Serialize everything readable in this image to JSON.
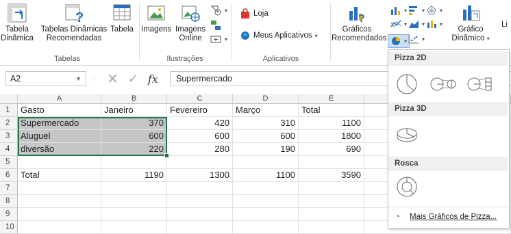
{
  "ribbon": {
    "tabelas": {
      "group_label": "Tabelas",
      "tabela_dinamica_line1": "Tabela",
      "tabela_dinamica_line2": "Dinâmica",
      "tabelas_recomendadas_line1": "Tabelas Dinâmicas",
      "tabelas_recomendadas_line2": "Recomendadas",
      "tabela": "Tabela"
    },
    "ilustracoes": {
      "group_label": "Ilustrações",
      "imagens": "Imagens",
      "imagens_online_line1": "Imagens",
      "imagens_online_line2": "Online"
    },
    "aplicativos": {
      "group_label": "Aplicativos",
      "loja": "Loja",
      "meus_aplicativos": "Meus Aplicativos"
    },
    "graficos": {
      "recomendados_line1": "Gráficos",
      "recomendados_line2": "Recomendados",
      "grafico_dinamico_line1": "Gráfico",
      "grafico_dinamico_line2": "Dinâmico",
      "cut_label": "Li"
    }
  },
  "formula_bar": {
    "name_box": "A2",
    "fx": "fx",
    "content": "Supermercado"
  },
  "sheet": {
    "columns": [
      "A",
      "B",
      "C",
      "D",
      "E"
    ],
    "rows": [
      "1",
      "2",
      "3",
      "4",
      "5",
      "6",
      "7",
      "8",
      "9",
      "10"
    ],
    "cells": [
      [
        "Gasto",
        "Janeiro",
        "Fevereiro",
        "Março",
        "Total"
      ],
      [
        "Supermercado",
        "370",
        "420",
        "310",
        "1100"
      ],
      [
        "Aluguel",
        "600",
        "600",
        "600",
        "1800"
      ],
      [
        "diversão",
        "220",
        "280",
        "190",
        "690"
      ],
      [
        "",
        "",
        "",
        "",
        ""
      ],
      [
        "Total",
        "1190",
        "1300",
        "1100",
        "3590"
      ],
      [
        "",
        "",
        "",
        "",
        ""
      ],
      [
        "",
        "",
        "",
        "",
        ""
      ],
      [
        "",
        "",
        "",
        "",
        ""
      ],
      [
        "",
        "",
        "",
        "",
        ""
      ]
    ]
  },
  "pie_menu": {
    "pizza2d": "Pizza 2D",
    "pizza3d": "Pizza 3D",
    "rosca": "Rosca",
    "more": "Mais Gráficos de Pizza..."
  },
  "colors": {
    "excel_green": "#217346",
    "selection": "#c6c6c6"
  }
}
